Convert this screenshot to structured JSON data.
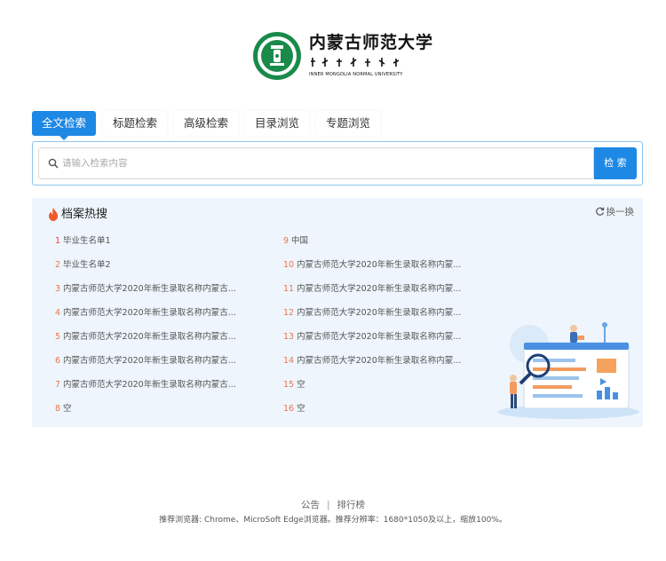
{
  "header": {
    "logo_chinese": "内蒙古师范大学",
    "logo_english": "INNER MONGOLIA NORMAL UNIVERSITY",
    "logo_seal_text": "内蒙古师范大学"
  },
  "tabs": [
    {
      "label": "全文检索",
      "active": true
    },
    {
      "label": "标题检索",
      "active": false
    },
    {
      "label": "高级检索",
      "active": false
    },
    {
      "label": "目录浏览",
      "active": false
    },
    {
      "label": "专题浏览",
      "active": false
    }
  ],
  "search": {
    "placeholder": "请输入检索内容",
    "value": "",
    "button_label": "检 索",
    "icon": "search-icon"
  },
  "hot": {
    "title": "档案热搜",
    "icon": "flame-icon",
    "refresh_label": "换一换",
    "refresh_icon": "refresh-icon",
    "left": [
      {
        "num": "1",
        "text": "毕业生名单1"
      },
      {
        "num": "2",
        "text": "毕业生名单2"
      },
      {
        "num": "3",
        "text": "内蒙古师范大学2020年新生录取名称内蒙古..."
      },
      {
        "num": "4",
        "text": "内蒙古师范大学2020年新生录取名称内蒙古..."
      },
      {
        "num": "5",
        "text": "内蒙古师范大学2020年新生录取名称内蒙古..."
      },
      {
        "num": "6",
        "text": "内蒙古师范大学2020年新生录取名称内蒙古..."
      },
      {
        "num": "7",
        "text": "内蒙古师范大学2020年新生录取名称内蒙古..."
      },
      {
        "num": "8",
        "text": "空"
      }
    ],
    "right": [
      {
        "num": "9",
        "text": "中国"
      },
      {
        "num": "10",
        "text": "内蒙古师范大学2020年新生录取名称内蒙..."
      },
      {
        "num": "11",
        "text": "内蒙古师范大学2020年新生录取名称内蒙..."
      },
      {
        "num": "12",
        "text": "内蒙古师范大学2020年新生录取名称内蒙..."
      },
      {
        "num": "13",
        "text": "内蒙古师范大学2020年新生录取名称内蒙..."
      },
      {
        "num": "14",
        "text": "内蒙古师范大学2020年新生录取名称内蒙..."
      },
      {
        "num": "15",
        "text": "空"
      },
      {
        "num": "16",
        "text": "空"
      }
    ],
    "accent_colors": {
      "rank1": "#e64340",
      "rank_other": "#e8774f"
    }
  },
  "footer": {
    "link1": "公告",
    "separator": "|",
    "link2": "排行榜",
    "note": "推荐浏览器: Chrome、MicroSoft Edge浏览器。推荐分辨率：1680*1050及以上，缩放100%。"
  },
  "colors": {
    "primary": "#1e88e5",
    "logo_green": "#1a8a4a",
    "panel_bg": "#eef5fc"
  }
}
